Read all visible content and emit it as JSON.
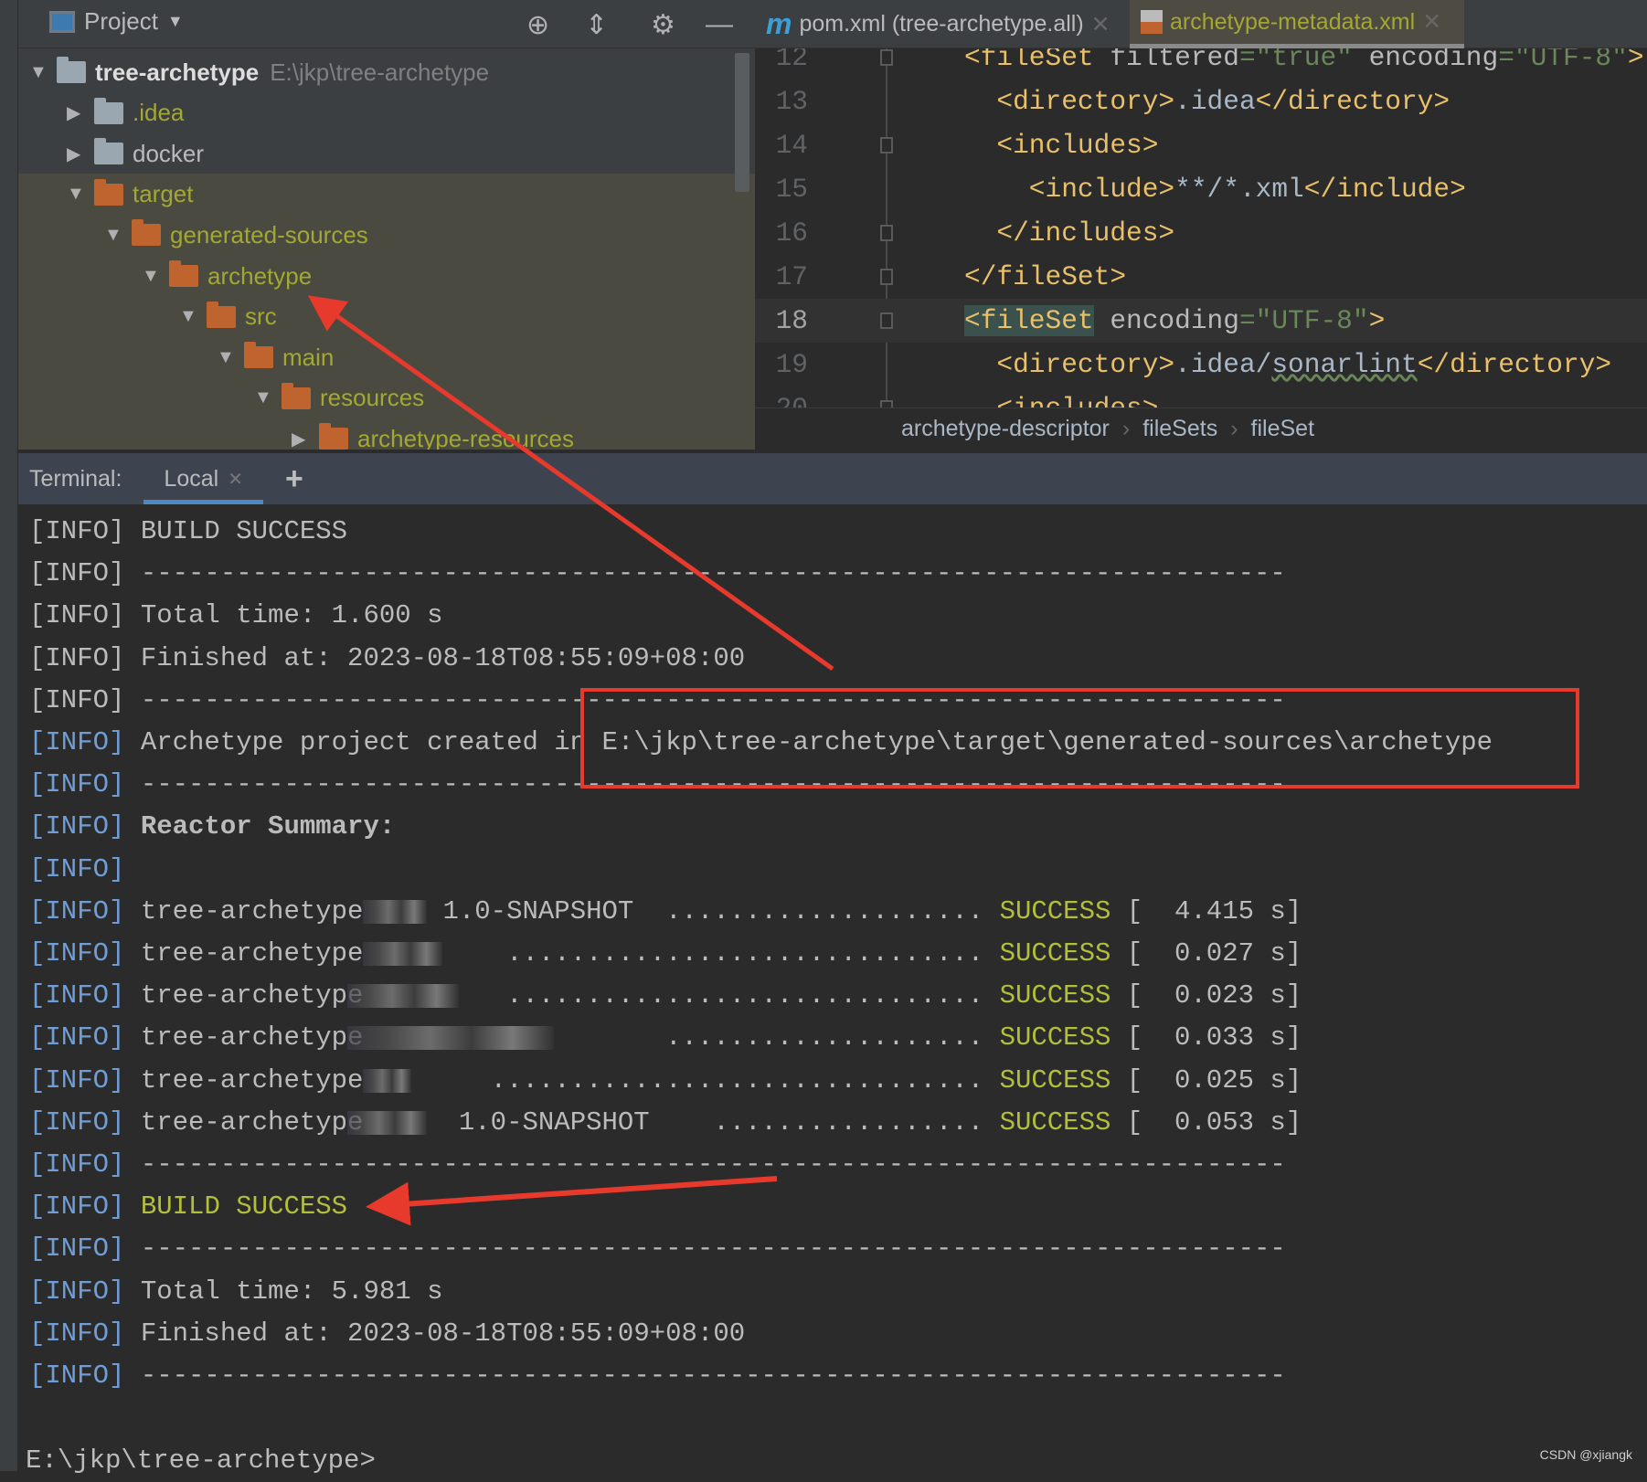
{
  "project_panel": {
    "title": "Project",
    "toolbar_icons": [
      "locate-icon",
      "collapse-all-icon",
      "gear-icon",
      "minimize-icon"
    ],
    "tree": [
      {
        "label": "tree-archetype",
        "path": "E:\\jkp\\tree-archetype",
        "depth": 0,
        "expanded": true,
        "type": "module",
        "bold": true
      },
      {
        "label": ".idea",
        "depth": 1,
        "expanded": false,
        "type": "folder",
        "color": "#a2a832"
      },
      {
        "label": "docker",
        "depth": 1,
        "expanded": false,
        "type": "folder",
        "color": "#bbbbbb"
      },
      {
        "label": "target",
        "depth": 1,
        "expanded": true,
        "type": "excluded",
        "color": "#a2a832"
      },
      {
        "label": "generated-sources",
        "depth": 2,
        "expanded": true,
        "type": "excluded",
        "color": "#a2a832"
      },
      {
        "label": "archetype",
        "depth": 3,
        "expanded": true,
        "type": "excluded",
        "color": "#a2a832"
      },
      {
        "label": "src",
        "depth": 4,
        "expanded": true,
        "type": "excluded",
        "color": "#a2a832"
      },
      {
        "label": "main",
        "depth": 5,
        "expanded": true,
        "type": "excluded",
        "color": "#a2a832"
      },
      {
        "label": "resources",
        "depth": 6,
        "expanded": true,
        "type": "excluded",
        "color": "#a2a832"
      },
      {
        "label": "archetype-resources",
        "depth": 7,
        "expanded": false,
        "type": "excluded",
        "color": "#a2a832"
      }
    ]
  },
  "editor": {
    "tabs": [
      {
        "label": "pom.xml (tree-archetype.all)",
        "icon": "maven-icon",
        "active": false
      },
      {
        "label": "archetype-metadata.xml",
        "icon": "xml-file-icon",
        "active": true
      }
    ],
    "lines": [
      {
        "n": "12",
        "tokens": [
          [
            "<fileSet ",
            "tag"
          ],
          [
            "filtered",
            "attr"
          ],
          [
            "=\"true\" ",
            "val"
          ],
          [
            "encoding",
            "attr"
          ],
          [
            "=\"UTF-8\"",
            "val"
          ],
          [
            ">",
            "tag"
          ]
        ]
      },
      {
        "n": "13",
        "tokens": [
          [
            "  <directory>",
            "tag"
          ],
          [
            ".idea",
            "text"
          ],
          [
            "</directory>",
            "tag"
          ]
        ]
      },
      {
        "n": "14",
        "tokens": [
          [
            "  <includes>",
            "tag"
          ]
        ]
      },
      {
        "n": "15",
        "tokens": [
          [
            "    <include>",
            "tag"
          ],
          [
            "**/*.xml",
            "text"
          ],
          [
            "</include>",
            "tag"
          ]
        ]
      },
      {
        "n": "16",
        "tokens": [
          [
            "  </includes>",
            "tag"
          ]
        ]
      },
      {
        "n": "17",
        "tokens": [
          [
            "</fileSet>",
            "tag"
          ]
        ]
      },
      {
        "n": "18",
        "tokens": [
          [
            "<fileSet",
            "taghl"
          ],
          [
            " encoding",
            "attr"
          ],
          [
            "=\"UTF-8\"",
            "val"
          ],
          [
            ">",
            "tag"
          ]
        ],
        "current": true
      },
      {
        "n": "19",
        "tokens": [
          [
            "  <directory>",
            "tag"
          ],
          [
            ".idea/",
            "text"
          ],
          [
            "sonarlint",
            "typo"
          ],
          [
            "</directory>",
            "tag"
          ]
        ]
      },
      {
        "n": "20",
        "tokens": [
          [
            "  <includes>",
            "tag"
          ]
        ]
      }
    ],
    "breadcrumb": [
      "archetype-descriptor",
      "fileSets",
      "fileSet"
    ]
  },
  "terminal": {
    "label": "Terminal:",
    "tab": "Local",
    "add_label": "+",
    "lines": [
      {
        "info": "[INFO]",
        "text": " BUILD SUCCESS",
        "blue": false
      },
      {
        "info": "[INFO]",
        "text": " ------------------------------------------------------------------------",
        "blue": false
      },
      {
        "info": "[INFO]",
        "text": " Total time: 1.600 s",
        "blue": false
      },
      {
        "info": "[INFO]",
        "text": " Finished at: 2023-08-18T08:55:09+08:00",
        "blue": false
      },
      {
        "info": "[INFO]",
        "text": " ------------------------------------------------------------------------",
        "blue": false
      },
      {
        "info": "[INFO]",
        "text": " Archetype project created in E:\\jkp\\tree-archetype\\target\\generated-sources\\archetype",
        "blue": true
      },
      {
        "info": "[INFO]",
        "text": " ------------------------------------------------------------------------",
        "blue": true
      },
      {
        "info": "[INFO]",
        "text": " Reactor Summary:",
        "blue": true,
        "bold": true
      },
      {
        "info": "[INFO]",
        "text": "",
        "blue": true
      },
      {
        "info": "[INFO]",
        "text": " tree-archetype",
        "blue": true,
        "version": "1.0-SNAPSHOT",
        "dots": "....................",
        "status": "SUCCESS",
        "time": "[  4.415 s]"
      },
      {
        "info": "[INFO]",
        "text": " tree-archetype",
        "blue": true,
        "version": "",
        "dots": "..............................",
        "status": "SUCCESS",
        "time": "[  0.027 s]"
      },
      {
        "info": "[INFO]",
        "text": " tree-archetype",
        "blue": true,
        "version": "",
        "dots": "..............................",
        "status": "SUCCESS",
        "time": "[  0.023 s]"
      },
      {
        "info": "[INFO]",
        "text": " tree-archetype",
        "blue": true,
        "version": "",
        "dots": "....................",
        "status": "SUCCESS",
        "time": "[  0.033 s]"
      },
      {
        "info": "[INFO]",
        "text": " tree-archetype",
        "blue": true,
        "version": "",
        "dots": "...............................",
        "status": "SUCCESS",
        "time": "[  0.025 s]"
      },
      {
        "info": "[INFO]",
        "text": " tree-archetype",
        "blue": true,
        "version": "1.0-SNAPSHOT",
        "dots": ".................",
        "status": "SUCCESS",
        "time": "[  0.053 s]"
      },
      {
        "info": "[INFO]",
        "text": " ------------------------------------------------------------------------",
        "blue": true
      },
      {
        "info": "[INFO]",
        "text": "",
        "blue": true,
        "status_only": "BUILD SUCCESS"
      },
      {
        "info": "[INFO]",
        "text": " ------------------------------------------------------------------------",
        "blue": true
      },
      {
        "info": "[INFO]",
        "text": " Total time: 5.981 s",
        "blue": true
      },
      {
        "info": "[INFO]",
        "text": " Finished at: 2023-08-18T08:55:09+08:00",
        "blue": true
      },
      {
        "info": "[INFO]",
        "text": " ------------------------------------------------------------------------",
        "blue": true
      }
    ],
    "prompt": "E:\\jkp\\tree-archetype>"
  },
  "colors": {
    "accent_red": "#e8392d",
    "success": "#b3bf3a",
    "info_blue": "#6f9dd6",
    "excluded_folder": "#c0642f"
  },
  "watermark": "CSDN @xjiangk"
}
